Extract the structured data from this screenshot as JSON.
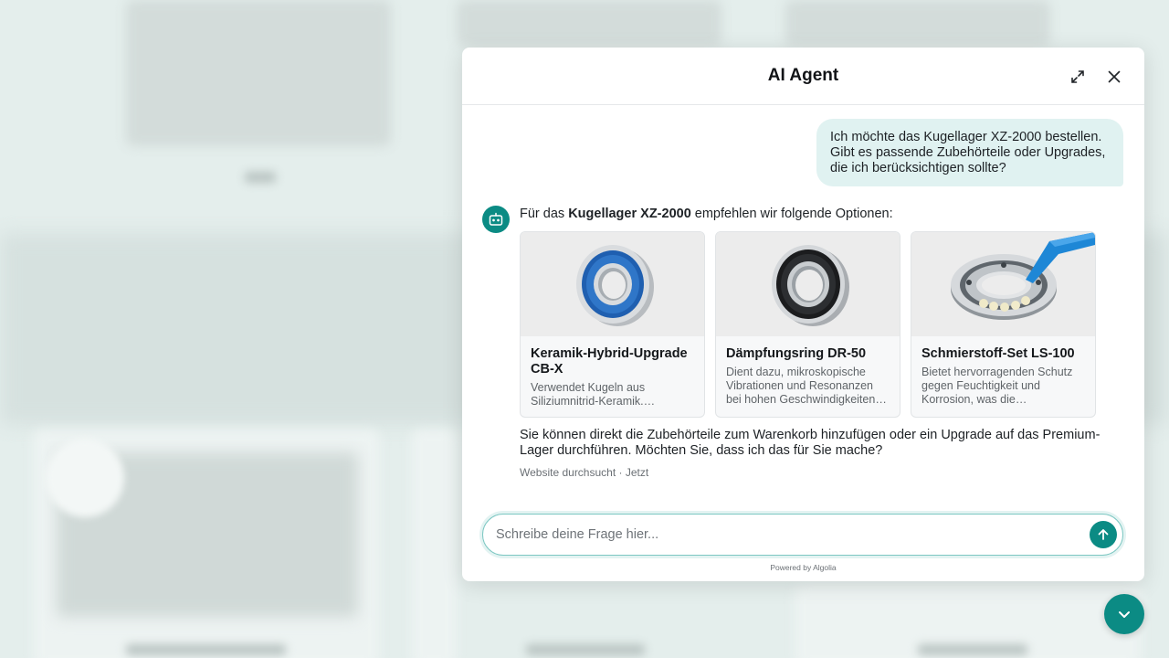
{
  "chat": {
    "title": "AI Agent",
    "user_message": "Ich möchte das Kugellager XZ-2000 bestellen. Gibt es passende Zubehörteile oder Upgrades, die ich berücksichtigen sollte?",
    "bot_intro_prefix": "Für das ",
    "bot_intro_product": "Kugellager XZ-2000",
    "bot_intro_suffix": " empfehlen wir folgende Optionen:",
    "products": [
      {
        "name": "Keramik-Hybrid-Upgrade CB-X",
        "description": "Verwendet Kugeln aus Siliziumnitrid-Keramik. Geringere Reibung und höhere Drehzahlen.",
        "image": "blue-sealed-bearing"
      },
      {
        "name": "Dämpfungsring DR-50",
        "description": "Dient dazu, mikroskopische Vibrationen und Resonanzen bei hohen Geschwindigkeiten zu absorbieren.",
        "image": "black-sealed-bearing"
      },
      {
        "name": "Schmierstoff-Set LS-100",
        "description": "Bietet hervorragenden Schutz gegen Feuchtigkeit und Korrosion, was die Lebensdauer des Lagers erhöht.",
        "image": "open-bearing-with-grease"
      }
    ],
    "bot_follow_up": "Sie können direkt die Zubehörteile zum Warenkorb hinzufügen oder ein Upgrade auf das Premium-Lager durchführen. Möchten Sie, dass ich das für Sie mache?",
    "meta_source": "Website durchsucht",
    "meta_separator": "·",
    "meta_time": "Jetzt",
    "input_placeholder": "Schreibe deine Frage hier...",
    "powered_by": "Powered by Algolia"
  },
  "colors": {
    "accent": "#0b8b84",
    "user_bubble": "#e0f2f1"
  }
}
